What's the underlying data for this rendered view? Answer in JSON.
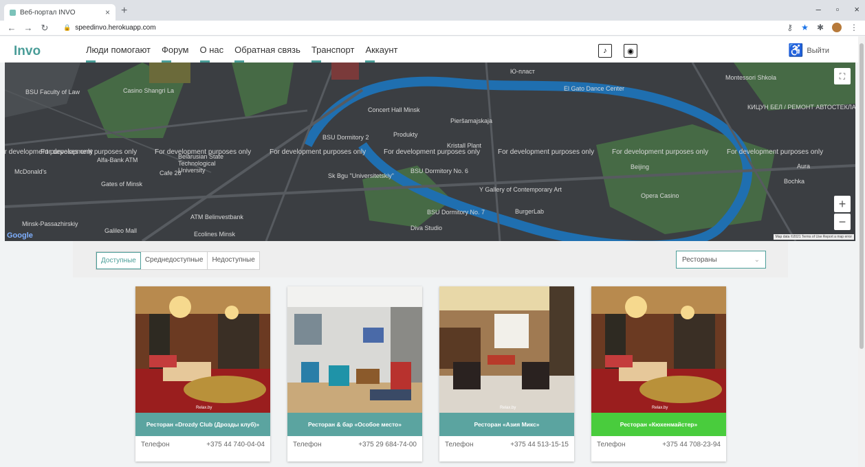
{
  "browser": {
    "tab_title": "Веб-портал INVO",
    "tab_close": "×",
    "new_tab": "+",
    "url": "speedinvo.herokuapp.com",
    "window_controls": [
      "–",
      "▫",
      "×"
    ]
  },
  "header": {
    "logo": "Invo",
    "nav": [
      "Люди помогают",
      "Форум",
      "О нас",
      "Обратная связь",
      "Транспорт",
      "Аккаунт"
    ],
    "logout": "Выйти",
    "accent_color": "#4a9d98"
  },
  "map": {
    "dev_notice": "For development purposes only",
    "pois": [
      "BSU Faculty of Law",
      "Casino Shangri La",
      "Concert Hall Minsk",
      "BSU Dormitory 2",
      "Produkty",
      "Kristall Plant",
      "Pieršamajskaja",
      "Ю-пласт",
      "El Gato Dance Center",
      "Montessori Shkola",
      "КИЦУН БЕЛ / РЕМОНТ АВТОСТЕКЛА",
      "Alfa-Bank ATM",
      "McDonald's",
      "Gates of Minsk",
      "Cafe 26",
      "Belarusian State Technological University",
      "Sk Bgu \"Universitetskiy\"",
      "BSU Dormitory No. 6",
      "Y Gallery of Contemporary Art",
      "BurgerLab",
      "Beijing",
      "Opera Casino",
      "Aura",
      "Bochka",
      "ATM Belinvestbank",
      "BSU Dormitory No. 7",
      "Diva Studio",
      "Minsk-Passazhirskiy",
      "Galileo Mall",
      "Ecolines Minsk"
    ],
    "attribution": "Map data ©2021  Terms of Use  Report a map error",
    "google": "Google"
  },
  "filters": {
    "tabs": [
      "Доступные",
      "Среднедоступные",
      "Недоступные"
    ],
    "active_index": 0,
    "category": "Рестораны"
  },
  "cards": [
    {
      "name": "Ресторан «Drozdy Club (Дрозды клуб)»",
      "phone_label": "Телефон",
      "phone": "+375 44 740-04-04",
      "highlight": false
    },
    {
      "name": "Ресторан & бар «Особое место»",
      "phone_label": "Телефон",
      "phone": "+375 29 684-74-00",
      "highlight": false
    },
    {
      "name": "Ресторан «Азия Микс»",
      "phone_label": "Телефон",
      "phone": "+375 44 513-15-15",
      "highlight": false
    },
    {
      "name": "Ресторан «Кюхенмайстер»",
      "phone_label": "Телефон",
      "phone": "+375 44 708-23-94",
      "highlight": true
    }
  ],
  "watermark": "Relax.by"
}
